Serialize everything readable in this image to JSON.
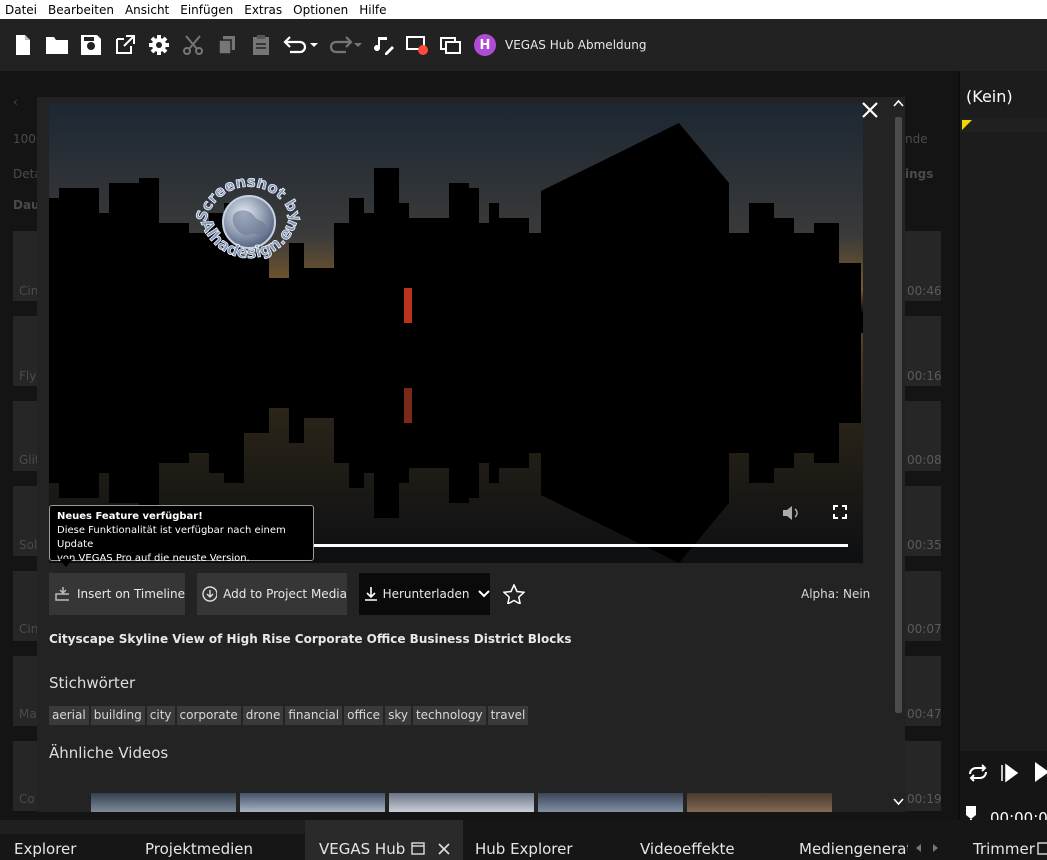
{
  "menu": [
    "Datei",
    "Bearbeiten",
    "Ansicht",
    "Einfügen",
    "Extras",
    "Optionen",
    "Hilfe"
  ],
  "toolbar": {
    "icons": [
      "new-file-icon",
      "open-folder-icon",
      "save-icon",
      "external-window-icon",
      "settings-gear-icon",
      "cut-icon",
      "copy-icon",
      "paste-icon",
      "undo-icon",
      "redo-icon",
      "music-edit-icon",
      "record-screen-icon",
      "window-overlay-icon"
    ],
    "hub_avatar": "H",
    "hub_label": "VEGAS Hub Abmeldung"
  },
  "background_panel": {
    "labels": [
      "1000",
      "Deta",
      "Dau",
      "Cin",
      "Fly",
      "Glit",
      "Sol",
      "Cin",
      "Ma",
      "Co"
    ],
    "right_labels": [
      "nde",
      "ings"
    ],
    "times": [
      "00:46",
      "00:16",
      "00:08",
      "00:35",
      "00:07",
      "00:47",
      "00:19"
    ]
  },
  "right_panel": {
    "preset": "(Kein)",
    "timecode": "00:00:0"
  },
  "modal": {
    "tooltip": {
      "title": "Neues Feature verfügbar!",
      "body_line1": "Diese Funktionalität ist verfügbar nach einem Update",
      "body_line2": "von VEGAS Pro auf die neuste Version."
    },
    "buttons": {
      "insert": "Insert on Timeline",
      "add": "Add to Project Media",
      "download": "Herunterladen"
    },
    "alpha": "Alpha: Nein",
    "title": "Cityscape Skyline View of High Rise Corporate Office Business District Blocks",
    "keywords_heading": "Stichwörter",
    "keywords": [
      "aerial",
      "building",
      "city",
      "corporate",
      "drone",
      "financial",
      "office",
      "sky",
      "technology",
      "travel"
    ],
    "similar_heading": "Ähnliche Videos"
  },
  "watermark": {
    "text_top": "Screenshot by",
    "text_bottom": "Alhadesign.eu"
  },
  "tabs": [
    "Explorer",
    "Projektmedien",
    "VEGAS Hub",
    "Hub Explorer",
    "Videoeffekte",
    "Mediengenerat",
    "Trimmer"
  ],
  "active_tab": "VEGAS Hub",
  "colors": {
    "accent_purple": "#b04bd6",
    "background": "#161616",
    "modal": "#232323"
  }
}
